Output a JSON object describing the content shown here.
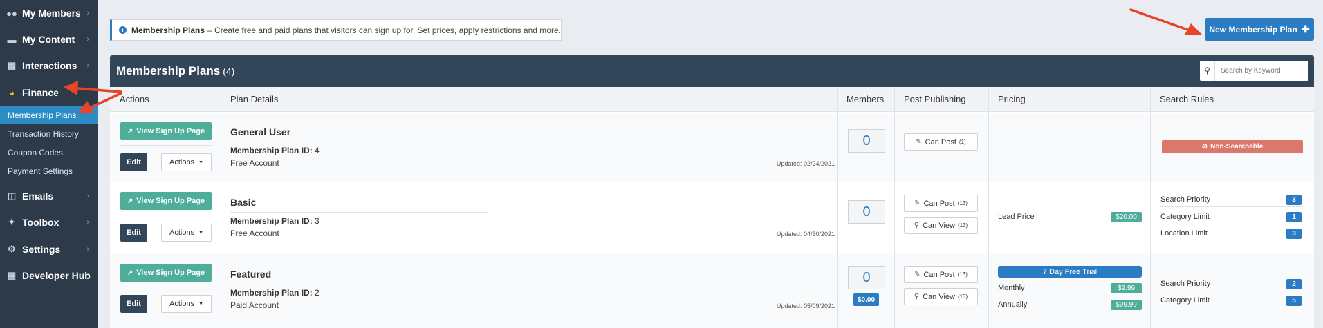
{
  "sidebar": {
    "items": [
      {
        "label": "My Members",
        "icon": "users-icon"
      },
      {
        "label": "My Content",
        "icon": "folder-icon"
      },
      {
        "label": "Interactions",
        "icon": "comments-icon"
      },
      {
        "label": "Finance",
        "icon": "pie-chart-icon"
      },
      {
        "label": "Emails",
        "icon": "inbox-icon"
      },
      {
        "label": "Toolbox",
        "icon": "wrench-icon"
      },
      {
        "label": "Settings",
        "icon": "gear-icon"
      },
      {
        "label": "Developer Hub",
        "icon": "grid-icon"
      }
    ],
    "finance_subitems": [
      {
        "label": "Membership Plans",
        "active": true
      },
      {
        "label": "Transaction History"
      },
      {
        "label": "Coupon Codes"
      },
      {
        "label": "Payment Settings"
      }
    ]
  },
  "banner": {
    "title": "Membership Plans",
    "text": "– Create free and paid plans that visitors can sign up for. Set prices, apply restrictions and more."
  },
  "new_plan_button": "New Membership Plan",
  "panel": {
    "title": "Membership Plans",
    "count": "(4)",
    "search_placeholder": "Search by Keyword"
  },
  "columns": [
    "Actions",
    "Plan Details",
    "Members",
    "Post Publishing",
    "Pricing",
    "Search Rules"
  ],
  "labels": {
    "view_signup": "View Sign Up Page",
    "edit": "Edit",
    "actions": "Actions",
    "plan_id_label": "Membership Plan ID:",
    "updated_label": "Updated:"
  },
  "plans": [
    {
      "name": "General User",
      "id": "4",
      "type": "Free Account",
      "updated": "02/24/2021",
      "members": "0",
      "can_post": "Can Post",
      "can_post_count": "(1)",
      "search_badge": "Non-Searchable"
    },
    {
      "name": "Basic",
      "id": "3",
      "type": "Free Account",
      "updated": "04/30/2021",
      "members": "0",
      "can_post": "Can Post",
      "can_post_count": "(13)",
      "can_view": "Can View",
      "can_view_count": "(13)",
      "lead_price_label": "Lead Price",
      "lead_price": "$20.00",
      "rules": [
        {
          "label": "Search Priority",
          "value": "3"
        },
        {
          "label": "Category Limit",
          "value": "1"
        },
        {
          "label": "Location Limit",
          "value": "3"
        }
      ]
    },
    {
      "name": "Featured",
      "id": "2",
      "type": "Paid Account",
      "updated": "05/09/2021",
      "members": "0",
      "members_price": "$0.00",
      "can_post": "Can Post",
      "can_post_count": "(13)",
      "can_view": "Can View",
      "can_view_count": "(13)",
      "trial": "7 Day Free Trial",
      "monthly_label": "Monthly",
      "monthly_price": "$9.99",
      "annual_label": "Annually",
      "annual_price": "$99.99",
      "rules": [
        {
          "label": "Search Priority",
          "value": "2"
        },
        {
          "label": "Category Limit",
          "value": "5"
        }
      ]
    }
  ],
  "colors": {
    "sidebar_bg": "#2d3a4a",
    "active_item": "#2c8cc6",
    "primary": "#2c7cc3",
    "teal": "#4fae9a",
    "header_dark": "#334659",
    "danger": "#da786c",
    "arrow": "#e8442a"
  }
}
